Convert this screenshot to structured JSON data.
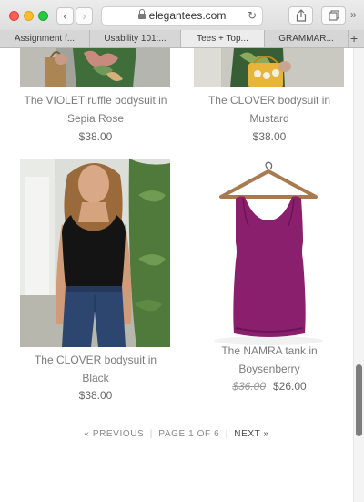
{
  "browser": {
    "url": "elegantees.com",
    "back_glyph": "‹",
    "forward_glyph": "›",
    "reload_glyph": "↻",
    "more_glyph": "»",
    "new_tab_glyph": "+",
    "tabs": [
      {
        "label": "Assignment f..."
      },
      {
        "label": "Usability 101:..."
      },
      {
        "label": "Tees + Top..."
      },
      {
        "label": "GRAMMAR..."
      }
    ]
  },
  "products": [
    {
      "title_line1": "The VIOLET ruffle bodysuit in",
      "title_line2": "Sepia Rose",
      "price": "$38.00"
    },
    {
      "title_line1": "The CLOVER bodysuit in",
      "title_line2": "Mustard",
      "price": "$38.00"
    },
    {
      "title_line1": "The CLOVER bodysuit in",
      "title_line2": "Black",
      "price": "$38.00"
    },
    {
      "title_line1": "The NAMRA tank in",
      "title_line2": "Boysenberry",
      "old_price": "$36.00",
      "price": "$26.00"
    }
  ],
  "pagination": {
    "previous": "« PREVIOUS",
    "page_info": "PAGE 1 OF 6",
    "next": "NEXT »"
  },
  "colors": {
    "tank": "#8a1f6e",
    "tank_shadow": "#6e1456"
  }
}
